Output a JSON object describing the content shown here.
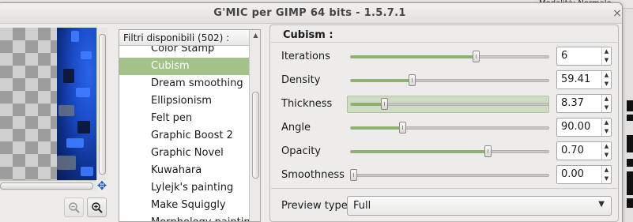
{
  "background": {
    "layer_label": "Modalità: Normale"
  },
  "window": {
    "title": "G'MIC per GIMP 64 bits - 1.5.7.1",
    "close_glyph": "×"
  },
  "preview": {
    "move_icon": "move-icon",
    "zoom_out_icon": "zoom-out-icon",
    "zoom_in_icon": "zoom-in-icon"
  },
  "filters": {
    "header": "Filtri disponibili (502) :",
    "items": [
      "Color Stamp",
      "Cubism",
      "Dream smoothing",
      "Ellipsionism",
      "Felt pen",
      "Graphic Boost 2",
      "Graphic Novel",
      "Kuwahara",
      "Lylejk's painting",
      "Make Squiggly",
      "Morphology painting"
    ],
    "selected_index": 1
  },
  "params": {
    "title": "Cubism :",
    "rows": [
      {
        "label": "Iterations",
        "value": "6",
        "fraction": 0.63,
        "highlight": false
      },
      {
        "label": "Density",
        "value": "59.41",
        "fraction": 0.31,
        "highlight": false
      },
      {
        "label": "Thickness",
        "value": "8.37",
        "fraction": 0.17,
        "highlight": true
      },
      {
        "label": "Angle",
        "value": "90.00",
        "fraction": 0.26,
        "highlight": false
      },
      {
        "label": "Opacity",
        "value": "0.70",
        "fraction": 0.69,
        "highlight": false
      },
      {
        "label": "Smoothness",
        "value": "0.00",
        "fraction": 0.0,
        "highlight": false
      }
    ],
    "preview_type_label": "Preview type",
    "preview_type_value": "Full"
  },
  "colors": {
    "selection": "#a3c288",
    "slider_fill": "#8fb170",
    "accent_blue": "#1f5fbd"
  }
}
